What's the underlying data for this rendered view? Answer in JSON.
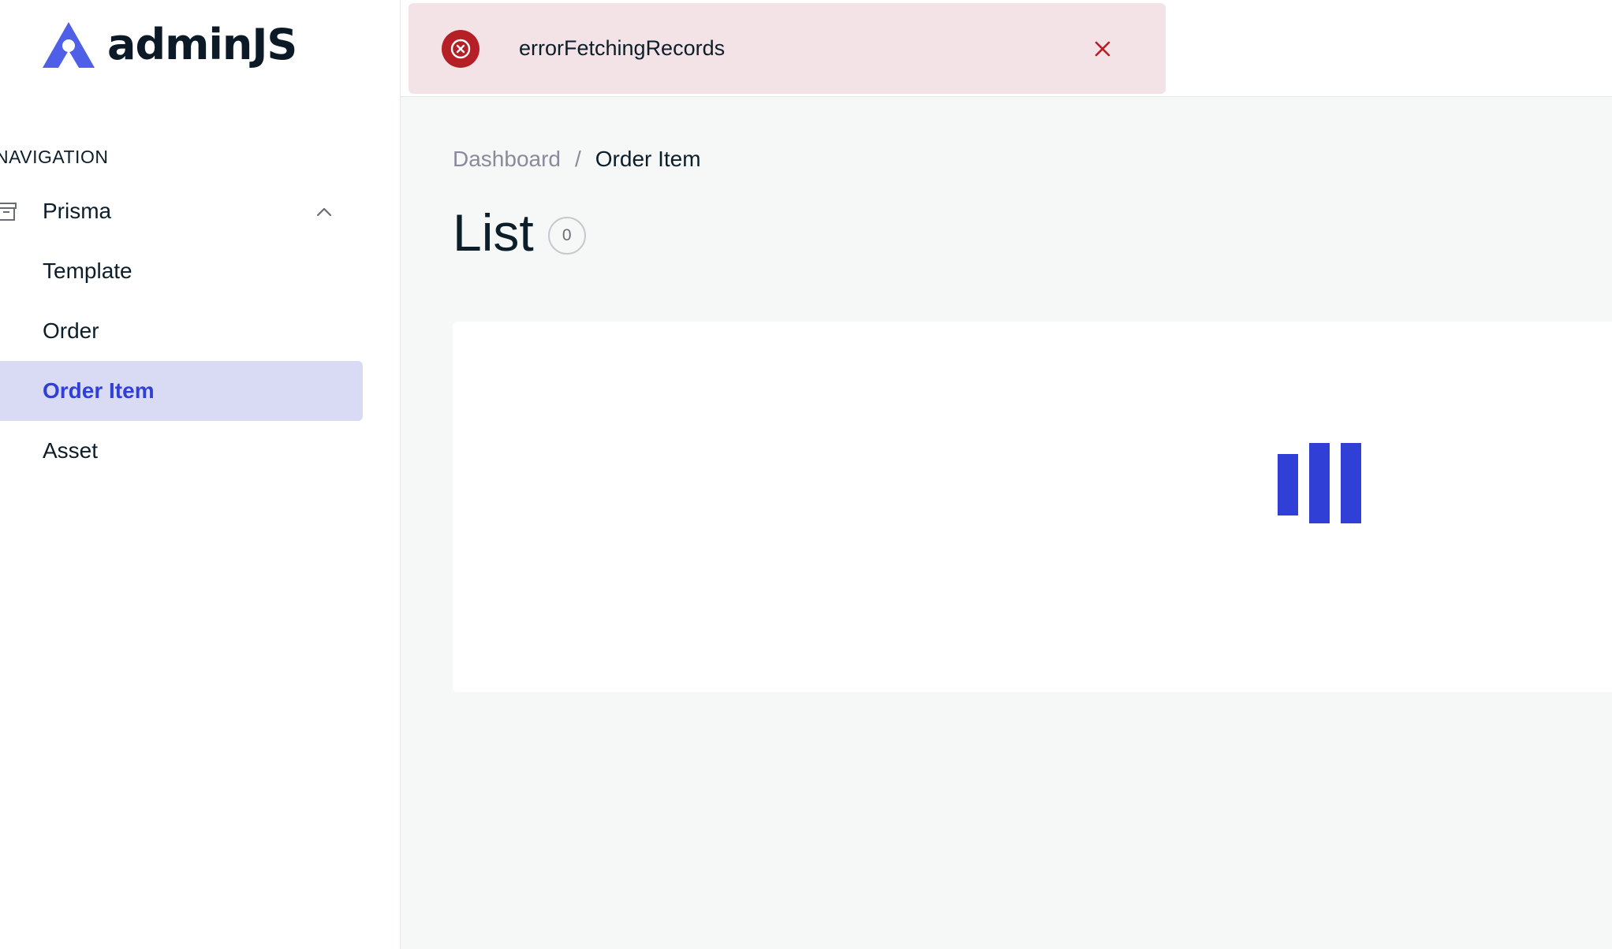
{
  "app": {
    "brand": "adminJS"
  },
  "sidebar": {
    "heading": "NAVIGATION",
    "group": {
      "label": "Prisma",
      "icon": "archive-icon",
      "expanded": true
    },
    "items": [
      {
        "label": "Template",
        "active": false
      },
      {
        "label": "Order",
        "active": false
      },
      {
        "label": "Order Item",
        "active": true
      },
      {
        "label": "Asset",
        "active": false
      }
    ]
  },
  "notification": {
    "type": "error",
    "message": "errorFetchingRecords",
    "icon": "error-circle-icon",
    "close_icon": "close-icon"
  },
  "breadcrumb": {
    "root": "Dashboard",
    "separator": "/",
    "current": "Order Item"
  },
  "page": {
    "title": "List",
    "count": "0"
  },
  "colors": {
    "accent": "#3040d6",
    "active_bg": "#d9dbf5",
    "error": "#b42025",
    "error_bg": "#f4e3e6",
    "logo": "#4f5fe8"
  }
}
